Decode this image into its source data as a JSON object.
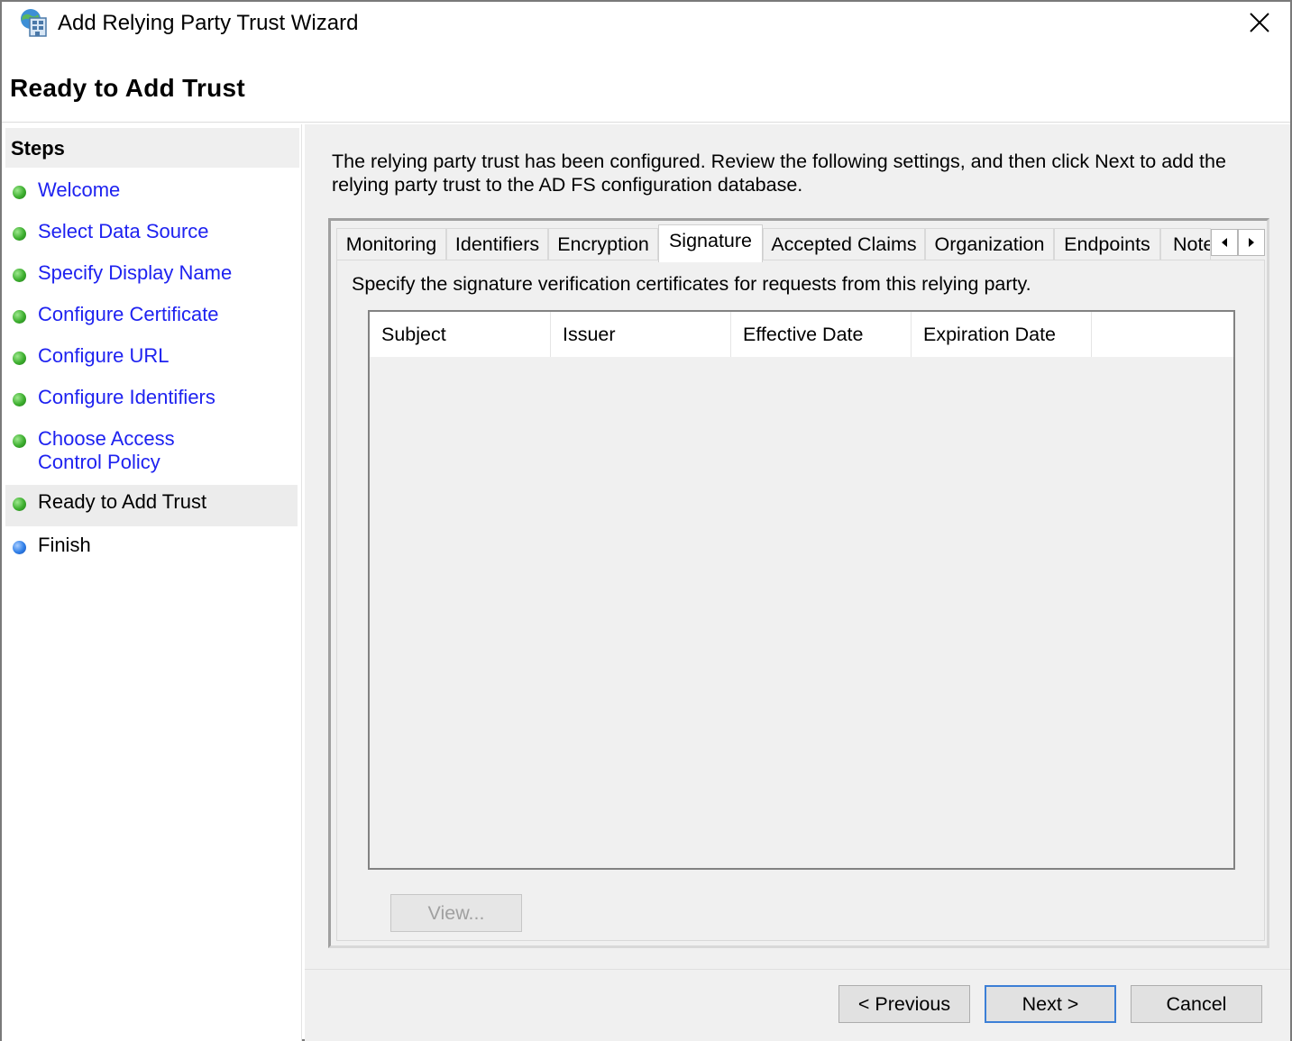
{
  "window": {
    "title": "Add Relying Party Trust Wizard",
    "close_symbol": "✕"
  },
  "page_heading": "Ready to Add Trust",
  "steps": {
    "title": "Steps",
    "items": [
      {
        "label": "Welcome",
        "status": "completed",
        "color": "#3cae2e"
      },
      {
        "label": "Select Data Source",
        "status": "completed",
        "color": "#3cae2e"
      },
      {
        "label": "Specify Display Name",
        "status": "completed",
        "color": "#3cae2e"
      },
      {
        "label": "Configure Certificate",
        "status": "completed",
        "color": "#3cae2e"
      },
      {
        "label": "Configure URL",
        "status": "completed",
        "color": "#3cae2e"
      },
      {
        "label": "Configure Identifiers",
        "status": "completed",
        "color": "#3cae2e"
      },
      {
        "label": "Choose Access Control Policy",
        "status": "completed",
        "color": "#3cae2e"
      },
      {
        "label": "Ready to Add Trust",
        "status": "current",
        "color": "#3cae2e"
      },
      {
        "label": "Finish",
        "status": "pending",
        "color": "#2f7fe8"
      }
    ]
  },
  "intro_text": "The relying party trust has been configured. Review the following settings, and then click Next to add the relying party trust to the AD FS configuration database.",
  "tabs": {
    "items": [
      "Monitoring",
      "Identifiers",
      "Encryption",
      "Signature",
      "Accepted Claims",
      "Organization",
      "Endpoints",
      "Note"
    ],
    "active": "Signature",
    "scroll_left_icon": "triangle-left-icon",
    "scroll_right_icon": "triangle-right-icon"
  },
  "signature_tab": {
    "description": "Specify the signature verification certificates for requests from this relying party.",
    "columns": [
      "Subject",
      "Issuer",
      "Effective Date",
      "Expiration Date"
    ],
    "rows": [],
    "view_button": "View..."
  },
  "footer": {
    "previous": "< Previous",
    "next": "Next >",
    "cancel": "Cancel"
  }
}
